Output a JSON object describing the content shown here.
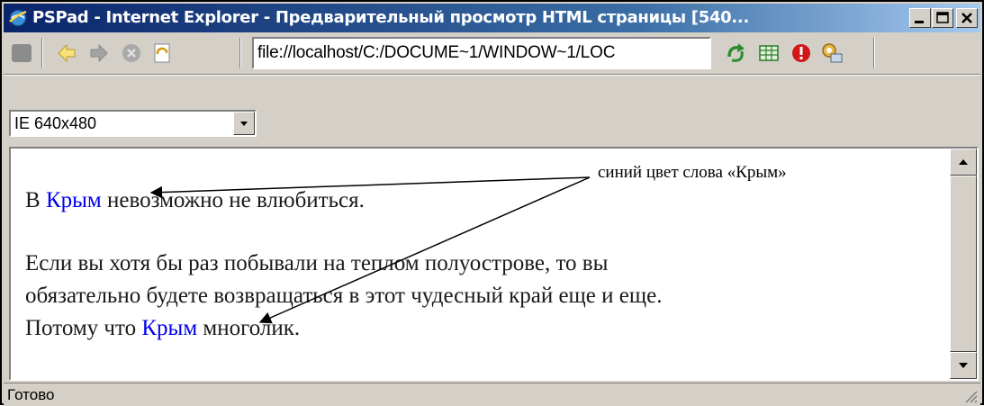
{
  "window": {
    "title": "PSPad - Internet Explorer - Предварительный просмотр HTML страницы  [540..."
  },
  "toolbar": {
    "url_value": "file://localhost/C:/DOCUME~1/WINDOW~1/LOC"
  },
  "view_mode": {
    "selected": "IE 640x480"
  },
  "page": {
    "p1": {
      "before": "В ",
      "keyword": "Крым",
      "after": " невозможно не влюбиться."
    },
    "p2": {
      "line1": "Если вы хотя бы раз побывали на теплом полуострове, то вы",
      "line2": "обязательно будете возвращаться в этот чудесный край еще и еще.",
      "line3_before": "Потому что ",
      "keyword": "Крым",
      "line3_after": " многолик."
    }
  },
  "annotation": {
    "text": "синий цвет слова «Крым»"
  },
  "status": {
    "text": "Готово"
  },
  "colors": {
    "keyword": "#0000ee",
    "titlebar_start": "#0a246a",
    "titlebar_end": "#a6caf0",
    "chrome": "#d4d0c8"
  },
  "icons": [
    "ie-globe-icon",
    "stop-square-icon",
    "back-icon",
    "forward-icon",
    "stop-icon",
    "refresh-icon",
    "go-icon",
    "table-icon",
    "warning-icon",
    "settings-icon",
    "minimize-icon",
    "maximize-icon",
    "close-icon",
    "dropdown-arrow-icon",
    "scroll-up-icon",
    "scroll-down-icon",
    "resize-grip-icon"
  ]
}
